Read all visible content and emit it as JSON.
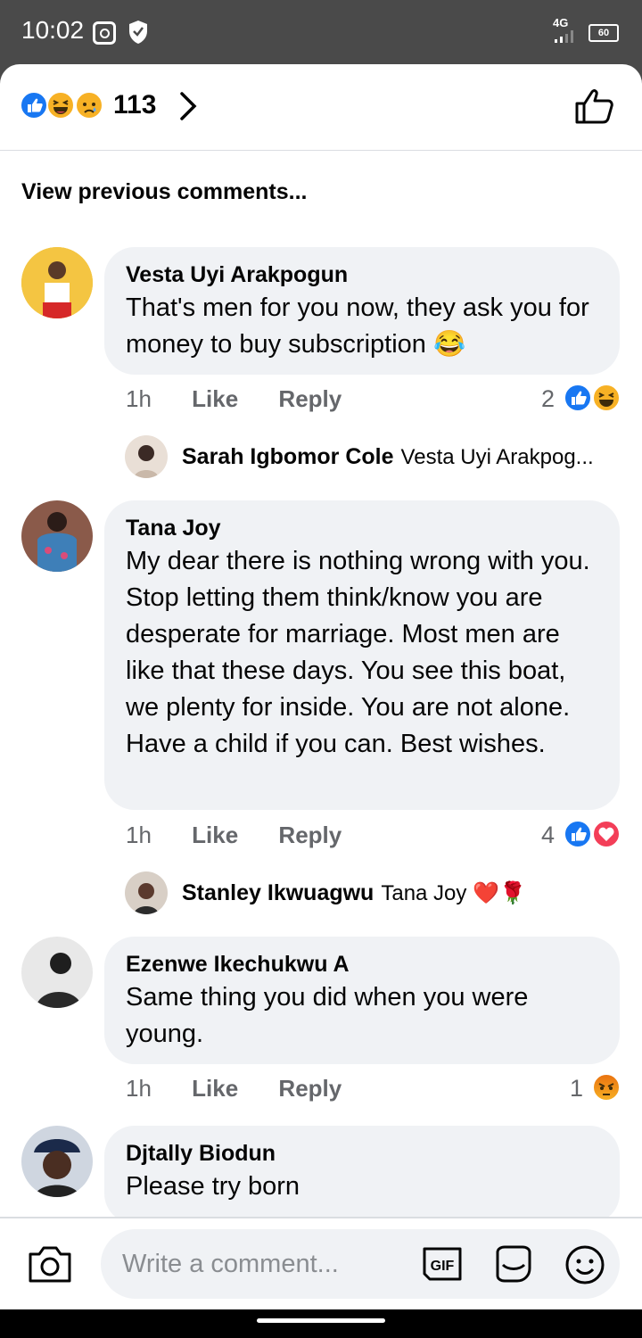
{
  "status_bar": {
    "time": "10:02",
    "network": "4G",
    "battery": "60"
  },
  "reactions_header": {
    "count": "113",
    "reaction_icons": [
      "like-icon",
      "haha-icon",
      "sad-icon"
    ]
  },
  "view_previous": "View previous comments...",
  "comments": [
    {
      "author": "Vesta Uyi Arakpogun",
      "text": "That's men for you now, they ask you for money to buy subscription 😂",
      "time": "1h",
      "like_label": "Like",
      "reply_label": "Reply",
      "reaction_count": "2",
      "reactions": [
        "like-icon",
        "haha-icon"
      ],
      "reply_preview": {
        "author": "Sarah Igbomor Cole",
        "text": "Vesta Uyi Arakpog..."
      }
    },
    {
      "author": "Tana Joy",
      "text": "My dear there is nothing wrong with you. Stop letting them think/know you are desperate for marriage. Most men are like that these days. You see this boat, we plenty for inside. You are not alone. Have a child if you can. Best wishes.",
      "time": "1h",
      "like_label": "Like",
      "reply_label": "Reply",
      "reaction_count": "4",
      "reactions": [
        "like-icon",
        "love-icon"
      ],
      "reply_preview": {
        "author": "Stanley Ikwuagwu",
        "text": "Tana Joy ❤️🌹"
      }
    },
    {
      "author": "Ezenwe Ikechukwu A",
      "text": "Same thing you did when you were young.",
      "time": "1h",
      "like_label": "Like",
      "reply_label": "Reply",
      "reaction_count": "1",
      "reactions": [
        "angry-icon"
      ]
    },
    {
      "author": "Djtally Biodun",
      "text": "Please try born"
    }
  ],
  "composer": {
    "placeholder": "Write a comment..."
  },
  "colors": {
    "bubble": "#f0f2f5",
    "like_blue": "#1877f2",
    "secondary_text": "#65676b",
    "status_bar": "#4a4a4a"
  }
}
